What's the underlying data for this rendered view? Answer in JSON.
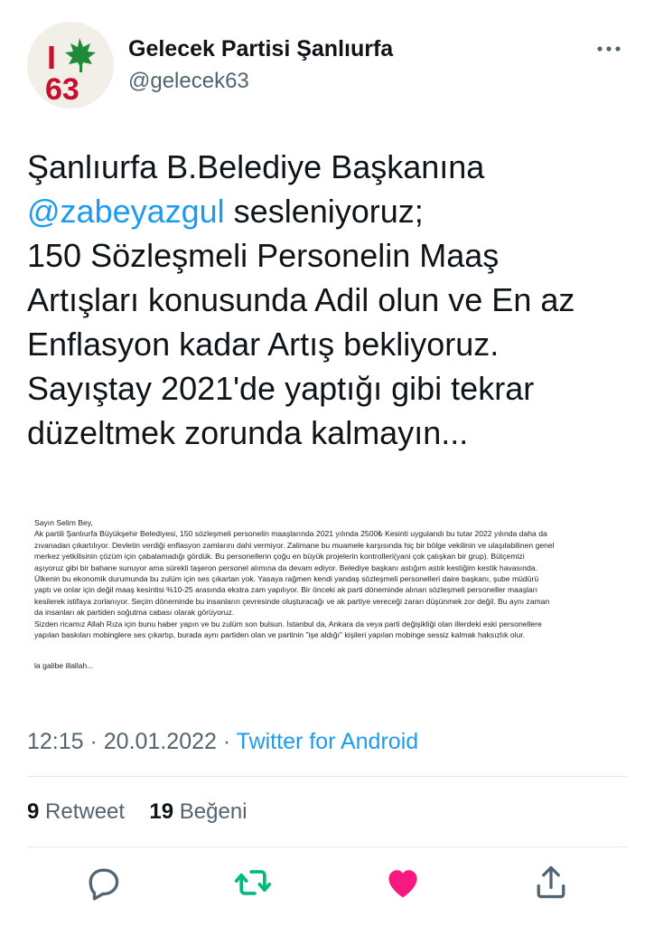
{
  "account": {
    "name": "Gelecek Partisi Şanlıurfa",
    "handle": "@gelecek63",
    "avatar_text": "I",
    "avatar_number": "63"
  },
  "tweet": {
    "line1": "Şanlıurfa B.Belediye Başkanına",
    "mention": "@zabeyazgul",
    "line2_rest": " sesleniyoruz;",
    "line3": "150 Sözleşmeli Personelin Maaş",
    "line4": "Artışları konusunda Adil olun ve En az",
    "line5": "Enflasyon kadar Artış bekliyoruz.",
    "line6": "Sayıştay 2021'de  yaptığı gibi tekrar",
    "line7": "düzeltmek zorunda kalmayın..."
  },
  "attachment": {
    "lines": [
      "Sayın Selim Bey,",
      "Ak partili  Şanlıurfa Büyükşehir Belediyesi, 150 sözleşmeli personelin maaşlarında 2021 yılında 2500₺ Kesinti uygulandı bu tutar 2022 yılında daha da",
      "zıvanadan çıkartılıyor. Devletin verdiği enflasyon zamlarını dahi vermiyor. Zalimane bu muamele karşısında hiç bir bölge vekilinin ve ulaşılabilinen genel",
      "merkez yetkilisinin çözüm için çabalamadığı gördük. Bu personellerin çoğu en büyük projelerin kontrolleri(yani çok çalışkan bir grup). Bütçemizi",
      "aşıyoruz gibi bir bahane sunuyor ama sürekli taşeron personel alımına da devam ediyor. Belediye başkanı astığım astık kestiğim kestik havasında.",
      "Ülkenin bu ekonomik durumunda bu zulüm için ses çıkartan yok. Yasaya rağmen kendi yandaş sözleşmeli personelleri daire başkanı, şube müdürü",
      "yaptı ve onlar için değil maaş kesintisi %10-25 arasında ekstra zam yapılıyor. Bir önceki ak parti döneminde alınan sözleşmeli personeller maaşları",
      "kesilerek istifaya zorlanıyor. Seçim döneminde bu insanların çevresinde oluşturacağı ve ak partiye vereceği zararı düşünmek zor değil. Bu aynı zaman",
      " da insanları ak partiden soğutma  cabası olarak görüyoruz.",
      "Sizden ricamız Allah Rıza için bunu haber yapın ve bu zulüm son bulsun. İstanbul da, Ankara da veya parti değişikliği olan illerdeki  eski personellere",
      "yapılan baskıları mobinglere ses çıkartıp, burada aynı partiden olan ve partinin \"işe aldığı\" kişileri yapılan mobinge sessiz kalmak haksızlık olur."
    ],
    "closing": "la galibe illallah..."
  },
  "meta": {
    "time": "12:15",
    "sep1": " · ",
    "date": "20.01.2022",
    "sep2": " · ",
    "source": "Twitter for Android"
  },
  "stats": {
    "retweets": "9",
    "retweets_label": " Retweet",
    "likes": "19",
    "likes_label": " Beğeni"
  },
  "icons": {
    "more": "more-horizontal-icon",
    "reply": "reply-icon",
    "retweet": "retweet-icon",
    "like": "heart-filled-icon",
    "share": "share-icon"
  },
  "colors": {
    "link": "#1d9bf0",
    "retweet": "#00ba7c",
    "like": "#f91880",
    "muted": "#536471",
    "avatar_green": "#1f8a3a",
    "avatar_red": "#c8102e"
  }
}
